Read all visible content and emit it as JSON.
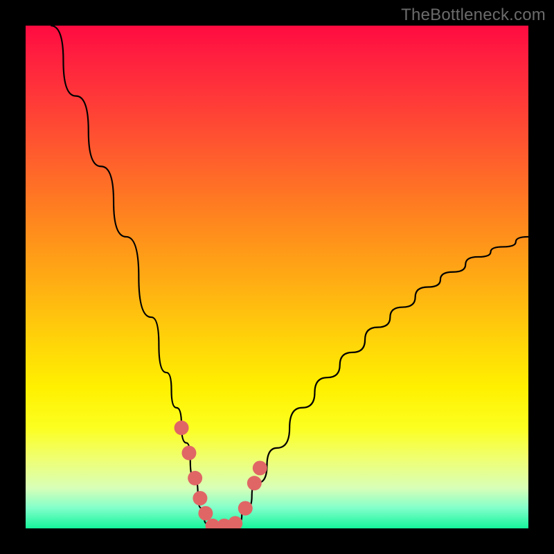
{
  "watermark": "TheBottleneck.com",
  "chart_data": {
    "type": "line",
    "title": "",
    "xlabel": "",
    "ylabel": "",
    "xlim": [
      0,
      100
    ],
    "ylim": [
      0,
      100
    ],
    "background_gradient": {
      "top_color": "#ff0a40",
      "bottom_color": "#15f49a",
      "meaning": "red high bottleneck, green low bottleneck"
    },
    "series": [
      {
        "name": "bottleneck-curve",
        "type": "line",
        "color": "#000000",
        "x": [
          5,
          10,
          15,
          20,
          25,
          28,
          30,
          32,
          33.5,
          35,
          36,
          37,
          38,
          40,
          42,
          44,
          46,
          50,
          55,
          60,
          65,
          70,
          75,
          80,
          85,
          90,
          95,
          100
        ],
        "values": [
          100,
          86,
          72,
          58,
          42,
          31,
          24,
          17,
          10,
          4,
          1,
          0,
          0,
          0,
          1,
          4,
          9,
          16,
          24,
          30,
          35,
          40,
          44,
          48,
          51,
          54,
          56,
          58
        ]
      },
      {
        "name": "highlight-markers",
        "type": "scatter",
        "color": "#e06666",
        "x": [
          31,
          32.5,
          33.7,
          34.7,
          35.8,
          37.2,
          39.5,
          41.7,
          43.7,
          45.5,
          46.6
        ],
        "values": [
          20,
          15,
          10,
          6,
          3,
          0.5,
          0.5,
          1,
          4,
          9,
          12
        ]
      }
    ]
  }
}
